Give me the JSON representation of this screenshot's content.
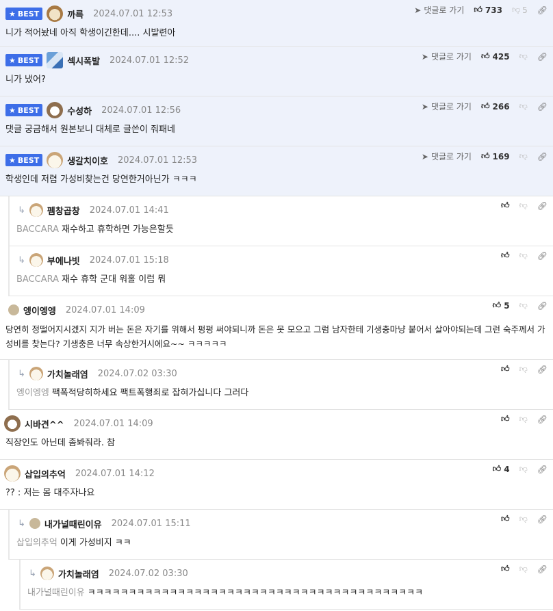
{
  "best_label": "BEST",
  "goto_label": "댓글로 가기",
  "comments": [
    {
      "nick": "까륵",
      "date": "2024.07.01 12:53",
      "text": "니가 적어놨네 아직 학생이긴한데.... 시발련아",
      "up": "733",
      "down": "5"
    },
    {
      "nick": "섹시폭발",
      "date": "2024.07.01 12:52",
      "text": "니가 냈어?",
      "up": "425",
      "down": ""
    },
    {
      "nick": "수성하",
      "date": "2024.07.01 12:56",
      "text": "댓글 궁금해서 원본보니 대체로 글쓴이 줘패네",
      "up": "266",
      "down": ""
    },
    {
      "nick": "생갈치이호",
      "date": "2024.07.01 12:53",
      "text": "학생인데 저렴 가성비찾는건 당연한거아닌가 ㅋㅋㅋ",
      "up": "169",
      "down": ""
    },
    {
      "nick": "펨창곱창",
      "date": "2024.07.01 14:41",
      "ref": "BACCARA",
      "text": "재수하고 휴학하면 가능은할듯",
      "up": "",
      "down": ""
    },
    {
      "nick": "부에나빗",
      "date": "2024.07.01 15:18",
      "ref": "BACCARA",
      "text": "재수 휴학 군대 워홀 이럼 뭐",
      "up": "",
      "down": ""
    },
    {
      "nick": "엥이엥엥",
      "date": "2024.07.01 14:09",
      "text": "당연히 정떨어지시겠지 지가 버는 돈은 자기를 위해서 펑펑 써야되니까 돈은 못 모으고 그럼 남자한테 기생충마냥 붙어서 살아야되는데 그런 숙주께서 가성비를 찾는다? 기생충은 너무 속상한거시에요~~ ㅋㅋㅋㅋㅋ",
      "up": "5",
      "down": ""
    },
    {
      "nick": "가치놀래염",
      "date": "2024.07.02 03:30",
      "ref": "엥이엥엥",
      "text": "팩폭적당히하세요 팩트폭행죄로 잡혀가십니다 그러다",
      "up": "",
      "down": ""
    },
    {
      "nick": "시바견^^",
      "date": "2024.07.01 14:09",
      "text": "직장인도 아닌데 좀봐줘라. 참",
      "up": "",
      "down": ""
    },
    {
      "nick": "삽입의추억",
      "date": "2024.07.01 14:12",
      "text": "?? : 저는 몸 대주자나요",
      "up": "4",
      "down": ""
    },
    {
      "nick": "내가널때린이유",
      "date": "2024.07.01 15:11",
      "ref": "삽입의추억",
      "text": "이게 가성비지 ㅋㅋ",
      "up": "",
      "down": ""
    },
    {
      "nick": "가치놀래염",
      "date": "2024.07.02 03:30",
      "ref": "내가널때린이유",
      "text": "ㅋㅋㅋㅋㅋㅋㅋㅋㅋㅋㅋㅋㅋㅋㅋㅋㅋㅋㅋㅋㅋㅋㅋㅋㅋㅋㅋㅋㅋㅋㅋㅋㅋㅋㅋㅋㅋㅋㅋㅋㅋ",
      "up": "",
      "down": ""
    }
  ]
}
